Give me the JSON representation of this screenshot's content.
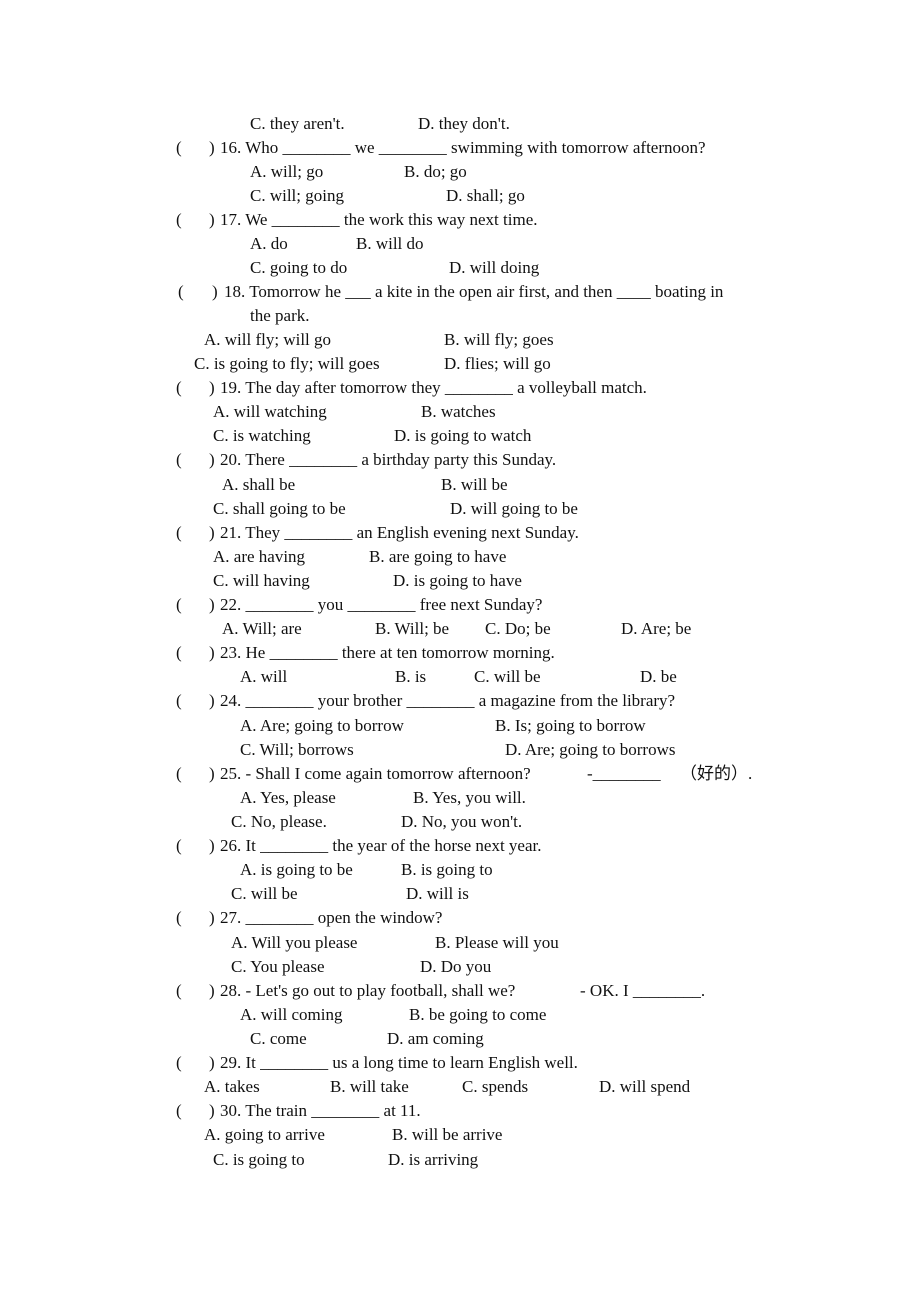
{
  "prefix_open": "(",
  "prefix_close": ")",
  "lines": {
    "q15": {
      "optC": "C. they aren't.",
      "optD": "D. they don't."
    },
    "q16": {
      "stem": "16. Who ________ we ________ swimming with tomorrow afternoon?",
      "optA": "A. will; go",
      "optB": "B. do; go",
      "optC": "C. will; going",
      "optD": "D. shall; go"
    },
    "q17": {
      "stem": "17. We ________ the work this way next time.",
      "optA": "A. do",
      "optB": "B. will do",
      "optC": "C. going to do",
      "optD": "D. will doing"
    },
    "q18": {
      "stem": "18. Tomorrow he ___ a kite in the open air first, and then ____ boating in",
      "stem2": "the park.",
      "optA": "A. will fly; will go",
      "optB": "B. will fly; goes",
      "optC": "C. is going to fly; will goes",
      "optD": "D. flies; will go"
    },
    "q19": {
      "stem": "19. The day after tomorrow they ________ a volleyball match.",
      "optA": "A. will watching",
      "optB": "B. watches",
      "optC": "C. is watching",
      "optD": "D. is going to watch"
    },
    "q20": {
      "stem": "20. There ________ a birthday party this Sunday.",
      "optA": "A. shall be",
      "optB": "B. will be",
      "optC": "C. shall going to be",
      "optD": "D. will going to be"
    },
    "q21": {
      "stem": "21. They ________ an English evening next Sunday.",
      "optA": "A. are having",
      "optB": "B. are going to have",
      "optC": "C. will having",
      "optD": "D. is going to have"
    },
    "q22": {
      "stem": "22. ________ you ________ free next Sunday?",
      "optA": "A. Will; are",
      "optB": "B. Will; be",
      "optC": "C. Do; be",
      "optD": "D. Are; be"
    },
    "q23": {
      "stem": "23. He ________ there at ten tomorrow morning.",
      "optA": "A. will",
      "optB": "B. is",
      "optC": "C. will be",
      "optD": "D. be"
    },
    "q24": {
      "stem": "24. ________ your brother ________ a magazine from the library?",
      "optA": "A. Are; going to borrow",
      "optB": "B. Is; going to borrow",
      "optC": "C. Will; borrows",
      "optD": "D. Are; going to borrows"
    },
    "q25": {
      "stem": "25. - Shall I come again tomorrow afternoon?",
      "reply": "-________",
      "hint": "（好的）.",
      "optA": "A. Yes, please",
      "optB": "B. Yes, you will.",
      "optC": "C. No, please.",
      "optD": "D. No, you won't."
    },
    "q26": {
      "stem": "26. It ________ the year of the horse next year.",
      "optA": "A. is going to be",
      "optB": "B. is going to",
      "optC": "C. will be",
      "optD": "D. will is"
    },
    "q27": {
      "stem": "27. ________ open the window?",
      "optA": "A. Will you please",
      "optB": "B. Please will you",
      "optC": "C. You please",
      "optD": "D. Do you"
    },
    "q28": {
      "stem": "28. - Let's go out to play football, shall we?",
      "reply": "- OK. I ________.",
      "optA": "A. will coming",
      "optB": "B. be going to come",
      "optC": "C. come",
      "optD": "D. am coming"
    },
    "q29": {
      "stem": "29. It ________ us a long time to learn English well.",
      "optA": "A. takes",
      "optB": "B. will take",
      "optC": "C. spends",
      "optD": "D. will spend"
    },
    "q30": {
      "stem": "30. The train ________ at 11.",
      "optA": "A. going to arrive",
      "optB": "B. will be arrive",
      "optC": "C. is going to",
      "optD": "D. is arriving"
    }
  }
}
